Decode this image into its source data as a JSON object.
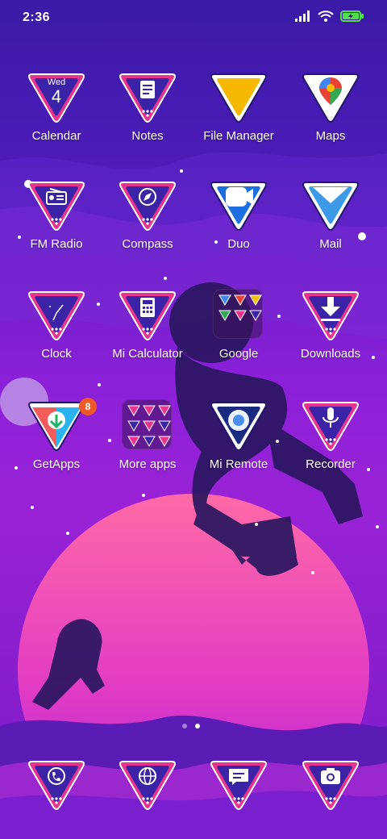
{
  "status_bar": {
    "time": "2:36",
    "icons": [
      "signal-icon",
      "wifi-icon",
      "battery-charging-icon"
    ]
  },
  "colors": {
    "accent_pink": "#e8348c",
    "icon_purple": "#3b23a8",
    "planet": "#f25a9a"
  },
  "apps": [
    {
      "label": "Calendar",
      "icon": "calendar-icon",
      "day": "Wed",
      "date": "4"
    },
    {
      "label": "Notes",
      "icon": "notes-icon"
    },
    {
      "label": "File Manager",
      "icon": "file-manager-icon"
    },
    {
      "label": "Maps",
      "icon": "maps-icon"
    },
    {
      "label": "FM Radio",
      "icon": "radio-icon"
    },
    {
      "label": "Compass",
      "icon": "compass-icon"
    },
    {
      "label": "Duo",
      "icon": "duo-video-icon"
    },
    {
      "label": "Mail",
      "icon": "mail-icon"
    },
    {
      "label": "Clock",
      "icon": "clock-icon"
    },
    {
      "label": "Mi Calculator",
      "icon": "calculator-icon"
    },
    {
      "label": "Google",
      "icon": "google-folder-icon"
    },
    {
      "label": "Downloads",
      "icon": "download-icon"
    },
    {
      "label": "GetApps",
      "icon": "getapps-icon",
      "badge": "8"
    },
    {
      "label": "More apps",
      "icon": "more-apps-folder-icon"
    },
    {
      "label": "Mi Remote",
      "icon": "remote-icon"
    },
    {
      "label": "Recorder",
      "icon": "microphone-icon"
    }
  ],
  "dock": [
    {
      "icon": "phone-icon"
    },
    {
      "icon": "browser-globe-icon"
    },
    {
      "icon": "messages-icon"
    },
    {
      "icon": "camera-icon"
    }
  ],
  "page_indicator": {
    "pages": 2,
    "current": 2
  }
}
